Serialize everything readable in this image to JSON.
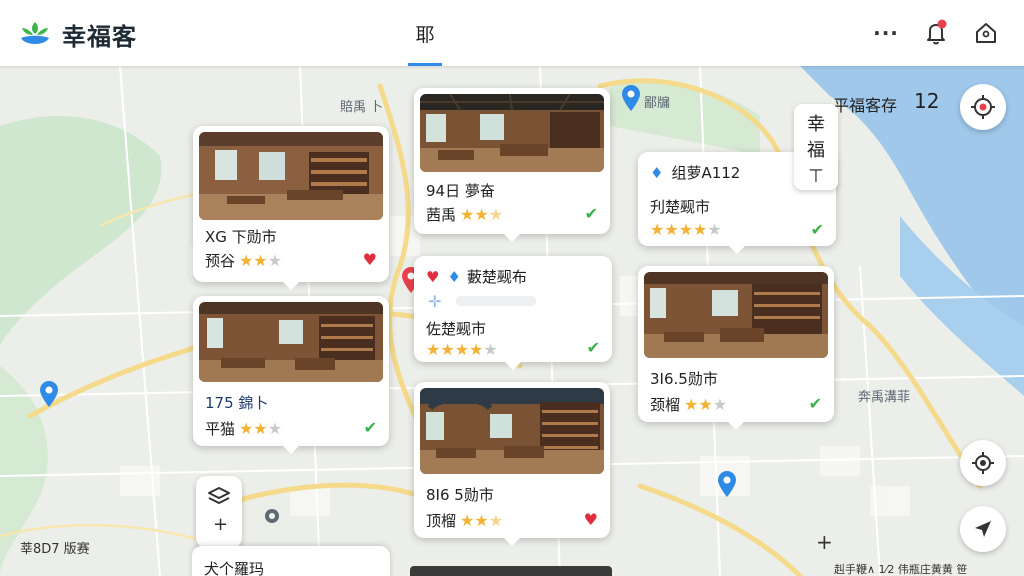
{
  "header": {
    "app_title": "幸福客",
    "tab_label": "耶",
    "more_label": "···"
  },
  "map": {
    "labels": {
      "top_center": "賠禹 卜",
      "top_right_pin": "鄙牖",
      "right_water": "奔禹溝菲",
      "bottom_left": "莘8D7 版赛",
      "bottom_right": "赳手鞭∧ 1⁄2  伟瓶庄黄黄 笹"
    },
    "counter": {
      "label": "平福客存",
      "value": "12"
    },
    "vertical_card": [
      "幸",
      "福",
      "⊤"
    ]
  },
  "cards": [
    {
      "id": "c1",
      "title": "XG 下勋市",
      "rating_label": "预谷",
      "stars": 2,
      "marker": "heart"
    },
    {
      "id": "c2",
      "title": "175 錦卜",
      "rating_label": "平猫",
      "stars": 2,
      "marker": "check"
    },
    {
      "id": "c3",
      "title": "94日 夢奋",
      "rating_label": "茜禹",
      "stars": 2.5,
      "marker": "check"
    },
    {
      "id": "c4",
      "title_top": "藪楚觋布",
      "title": "佐楚觋市",
      "rating_label": "",
      "stars": 4,
      "marker": "check"
    },
    {
      "id": "c5",
      "title": "8I6 5勋市",
      "rating_label": "顶榴",
      "stars": 2.5,
      "marker": "heart"
    },
    {
      "id": "c6",
      "title_top": "组萝A112",
      "title": "刋楚觋市",
      "rating_label": "",
      "stars": 4,
      "marker": "check"
    },
    {
      "id": "c7",
      "title": "3I6.5勋市",
      "rating_label": "颈榴",
      "stars": 2,
      "marker": "check"
    }
  ],
  "bottom_card": {
    "title": "犬个羅玛"
  },
  "colors": {
    "accent": "#2f8be6",
    "star": "#f2b233",
    "heart": "#e0303f",
    "check": "#39b14a",
    "pin": "#2f8be6",
    "alert": "#e8414b"
  }
}
